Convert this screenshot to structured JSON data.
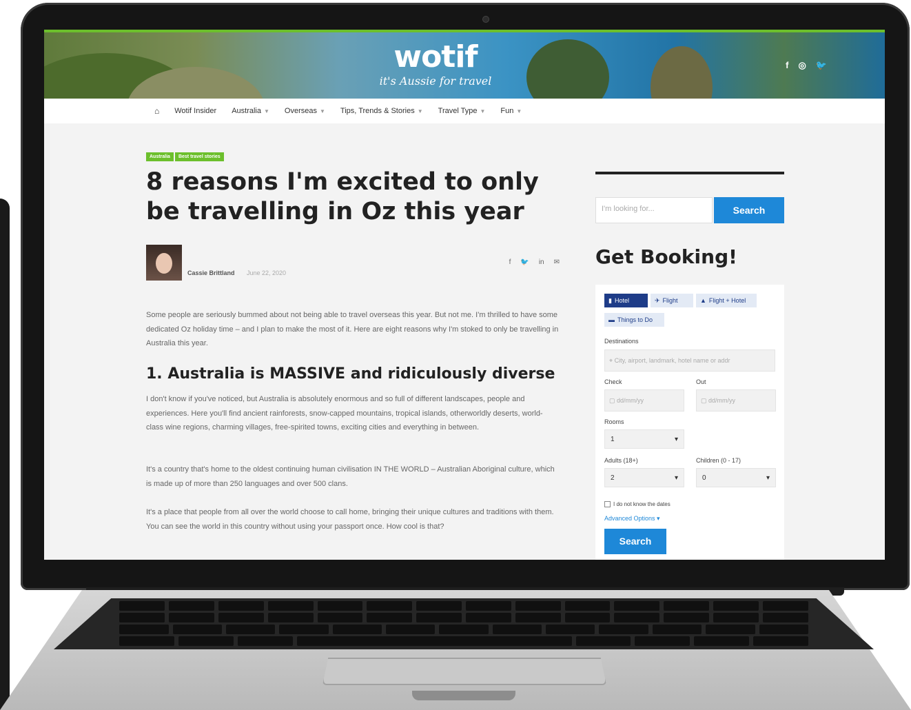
{
  "site": {
    "logo": "wotif",
    "tagline": "it's Aussie for travel",
    "social_icons": [
      "facebook-icon",
      "instagram-icon",
      "twitter-icon"
    ],
    "accent_color": "#6cbf2c"
  },
  "nav": {
    "home_icon": "home-icon",
    "items": [
      {
        "label": "Wotif Insider",
        "dropdown": false
      },
      {
        "label": "Australia",
        "dropdown": true
      },
      {
        "label": "Overseas",
        "dropdown": true
      },
      {
        "label": "Tips, Trends & Stories",
        "dropdown": true
      },
      {
        "label": "Travel Type",
        "dropdown": true
      },
      {
        "label": "Fun",
        "dropdown": true
      }
    ]
  },
  "article": {
    "tags": [
      "Australia",
      "Best travel stories"
    ],
    "title": "8 reasons I'm excited to only be travelling in Oz this year",
    "author": "Cassie Brittland",
    "date": "June 22, 2020",
    "share_icons": [
      "facebook-icon",
      "twitter-icon",
      "linkedin-icon",
      "email-icon"
    ],
    "intro": "Some people are seriously bummed about not being able to travel overseas this year. But not me. I'm thrilled to have some dedicated Oz holiday time – and I plan to make the most of it. Here are eight reasons why I'm stoked to only be travelling in Australia this year.",
    "section1_heading": "1. Australia is MASSIVE and ridiculously diverse",
    "section1_p1": "I don't know if you've noticed, but Australia is absolutely enormous and so full of different landscapes, people and experiences. Here you'll find ancient rainforests, snow-capped mountains, tropical islands, otherworldly deserts, world-class wine regions, charming villages, free-spirited towns, exciting cities and everything in between.",
    "section1_p2": "It's a country that's home to the oldest continuing human civilisation IN THE WORLD – Australian Aboriginal culture, which is made up of more than 250 languages and over 500 clans.",
    "section1_p3": "It's a place that people from all over the world choose to call home, bringing their unique cultures and traditions with them. You can see the world in this country without using your passport once. How cool is that?"
  },
  "sidebar": {
    "search_placeholder": "I'm looking for...",
    "search_button": "Search",
    "booking_title": "Get Booking!",
    "tabs": [
      {
        "label": "Hotel",
        "icon": "hotel-icon",
        "active": true
      },
      {
        "label": "Flight",
        "icon": "plane-icon",
        "active": false
      },
      {
        "label": "Flight + Hotel",
        "icon": "flight-hotel-icon",
        "active": false
      },
      {
        "label": "Things to Do",
        "icon": "ticket-icon",
        "active": false
      }
    ],
    "destination_label": "Destinations",
    "destination_placeholder": "City, airport, landmark, hotel name or addr",
    "check_label": "Check",
    "out_label": "Out",
    "date_placeholder": "dd/mm/yy",
    "rooms_label": "Rooms",
    "rooms_value": "1",
    "adults_label": "Adults (18+)",
    "adults_value": "2",
    "children_label": "Children (0 - 17)",
    "children_value": "0",
    "nodates_label": "I do not know the dates",
    "advanced_label": "Advanced Options ▾",
    "submit_label": "Search",
    "primary_color": "#1e88d8"
  }
}
